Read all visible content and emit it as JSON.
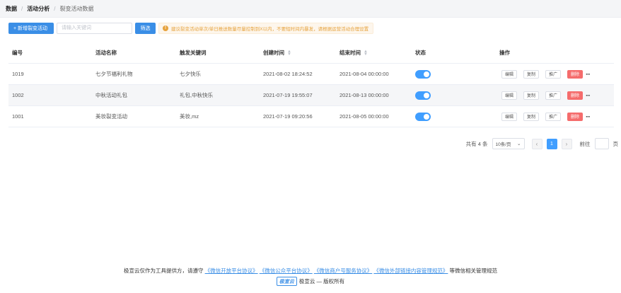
{
  "breadcrumb": {
    "items": [
      "数据",
      "活动分析",
      "裂变活动数据"
    ]
  },
  "toolbar": {
    "new_label": "+ 新增裂变活动",
    "search_placeholder": "请输入关键词",
    "search_value": "",
    "filter_label": "筛选",
    "warning_text": "建议裂变活动单次/单日推送数量尽量控制到X以内，不要短时间内暴发，请根据运营活动合理设置"
  },
  "table": {
    "headers": {
      "id": "编号",
      "name": "活动名称",
      "keyword": "触发关键词",
      "created": "创建时间",
      "end": "结束时间",
      "status": "状态",
      "actions": "操作"
    },
    "rows": [
      {
        "id": "1019",
        "name": "七夕节福利礼物",
        "keyword": "七夕快乐",
        "created": "2021-08-02 18:24:52",
        "end": "2021-08-04 00:00:00",
        "status_on": true
      },
      {
        "id": "1002",
        "name": "中秋活动礼包",
        "keyword": "礼包,中秋快乐",
        "created": "2021-07-19 19:55:07",
        "end": "2021-08-13 00:00:00",
        "status_on": true
      },
      {
        "id": "1001",
        "name": "美妆裂变活动",
        "keyword": "美妆,mz",
        "created": "2021-07-19 09:20:56",
        "end": "2021-08-05 00:00:00",
        "status_on": true
      }
    ],
    "action_labels": {
      "edit": "编辑",
      "copy": "复制",
      "promote": "推广",
      "delete": "删除",
      "more": "···"
    }
  },
  "pagination": {
    "total": "共有 4 条",
    "page_size": "10条/页",
    "current_page": "1",
    "goto_label": "前往",
    "page_suffix": "页"
  },
  "footer": {
    "prefix": "极宣云仅作为工具提供方，请遵守",
    "links": [
      "《微信开放平台协议》",
      "《微信公众平台协议》",
      "《微信商户号服务协议》",
      "《微信外部链接内容管理规范》"
    ],
    "suffix": "等微信相关管理规范",
    "logo_text": "极宣云",
    "copyright": "极宣云 — 版权所有"
  },
  "colors": {
    "primary": "#3a8ee6",
    "danger": "#f56c6c",
    "warning": "#e6a23c"
  }
}
